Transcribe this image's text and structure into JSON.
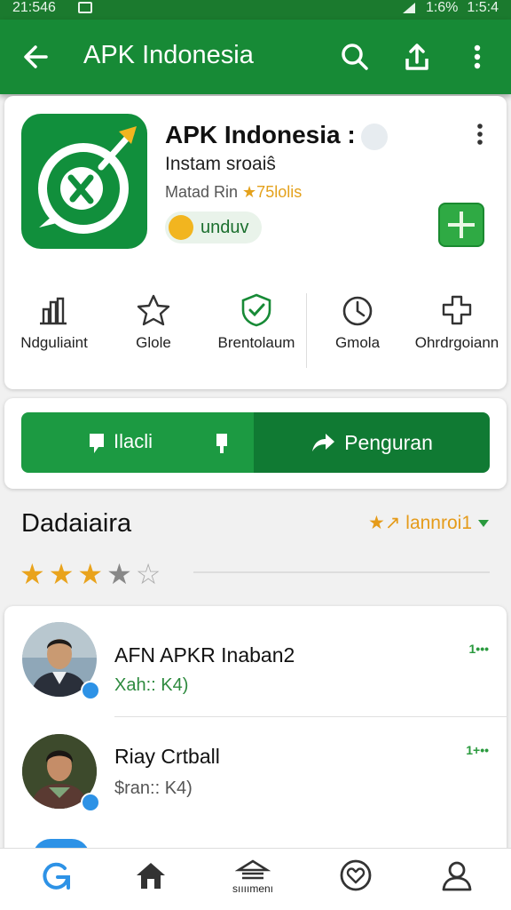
{
  "status_bar": {
    "time": "21:546",
    "battery": "1:6%",
    "clock": "1:5:4"
  },
  "app_bar": {
    "title": "APK Indonesia"
  },
  "app": {
    "name": "APK Indonesia :",
    "subtitle": "Instam sroaiŝ",
    "meta_prefix": "Matad Rin ",
    "rating": "★75lolis",
    "download_label": "unduv"
  },
  "stats": [
    {
      "icon": "chart-icon",
      "label": "Ndguliaint"
    },
    {
      "icon": "star-outline-icon",
      "label": "Glole"
    },
    {
      "icon": "shield-check-icon",
      "label": "Brentolaum"
    },
    {
      "icon": "clock-icon",
      "label": "Gmola"
    },
    {
      "icon": "puzzle-icon",
      "label": "Ohrdrgoiann"
    }
  ],
  "actions": {
    "left_label": "Ilacli",
    "right_label": "Penguran"
  },
  "reviews_section": {
    "title": "Dadaiaira",
    "sort_label": "★↗ lannroi1",
    "stars_filled": 3,
    "stars_total": 5
  },
  "reviews": [
    {
      "name": "AFN APKR Inaban2",
      "sub": "Xah:: K4)",
      "time": "1•••"
    },
    {
      "name": "Riay Crtball",
      "sub": "$ran:: K4)",
      "time": "1+••"
    }
  ],
  "bottom_nav": [
    {
      "icon": "refresh-icon",
      "label": ""
    },
    {
      "icon": "home-icon",
      "label": ""
    },
    {
      "icon": "library-icon",
      "label": "sıııımenı"
    },
    {
      "icon": "heart-icon",
      "label": ""
    },
    {
      "icon": "profile-icon",
      "label": ""
    }
  ],
  "colors": {
    "primary": "#178a36",
    "primary_dark": "#107a33",
    "accent": "#e59b1a",
    "verified": "#2d92e6"
  }
}
